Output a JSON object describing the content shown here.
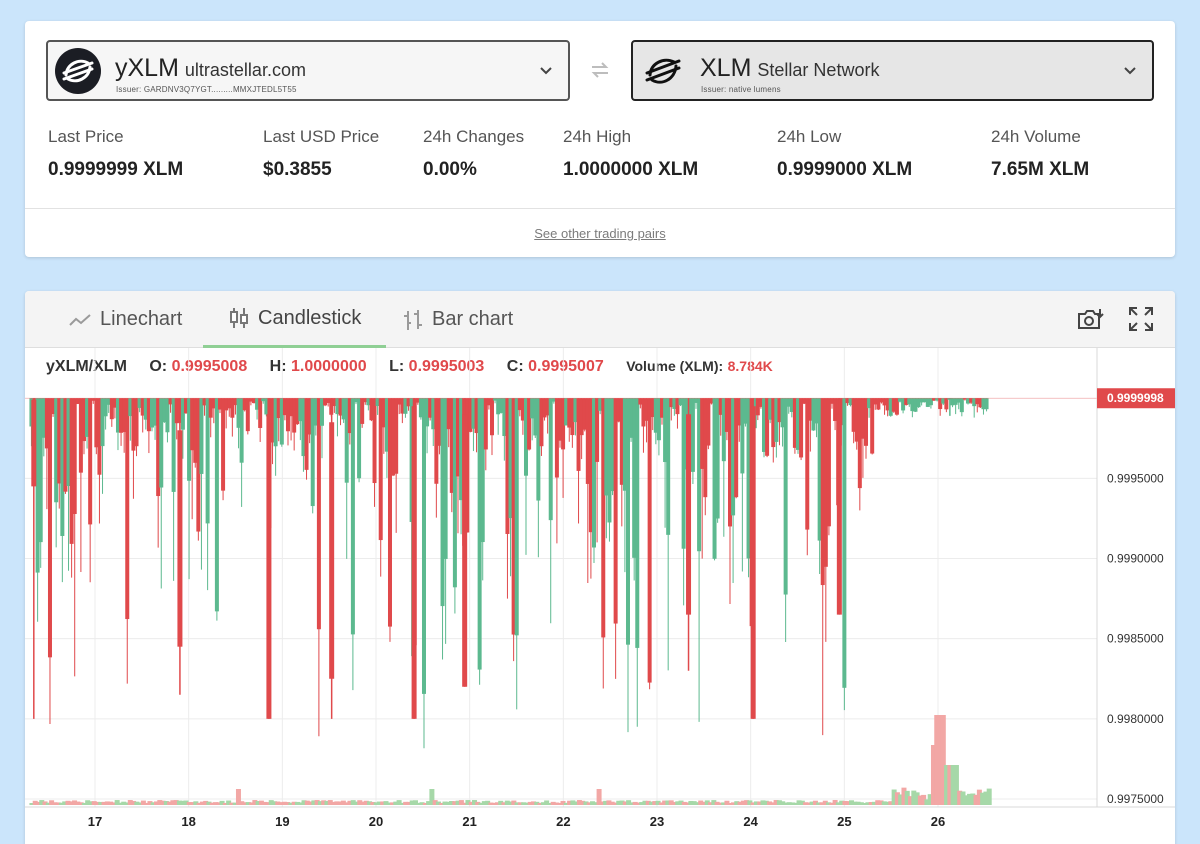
{
  "pair": {
    "base": {
      "code": "yXLM",
      "domain": "ultrastellar.com",
      "issuer": "Issuer: GARDNV3Q7YGT.........MMXJTEDL5T55",
      "icon": "stellar-rocket-icon"
    },
    "counter": {
      "code": "XLM",
      "domain": "Stellar Network",
      "issuer": "Issuer: native lumens",
      "icon": "stellar-rocket-icon"
    },
    "swap_icon": "swap-arrows-icon"
  },
  "stats": [
    {
      "label": "Last Price",
      "value": "0.9999999 XLM"
    },
    {
      "label": "Last USD Price",
      "value": "$0.3855"
    },
    {
      "label": "24h Changes",
      "value": "0.00%"
    },
    {
      "label": "24h High",
      "value": "1.0000000 XLM"
    },
    {
      "label": "24h Low",
      "value": "0.9999000 XLM"
    },
    {
      "label": "24h Volume",
      "value": "7.65M XLM"
    }
  ],
  "other_pairs_link": "See other trading pairs",
  "tabs": [
    {
      "label": "Linechart",
      "icon": "linechart-icon",
      "active": false
    },
    {
      "label": "Candlestick",
      "icon": "candlestick-icon",
      "active": true
    },
    {
      "label": "Bar chart",
      "icon": "barchart-icon",
      "active": false
    }
  ],
  "tools": {
    "screenshot_icon": "camera-icon",
    "fullscreen_icon": "fullscreen-icon"
  },
  "legend": {
    "pair": "yXLM/XLM",
    "o_label": "O:",
    "o_value": "0.9995008",
    "h_label": "H:",
    "h_value": "1.0000000",
    "l_label": "L:",
    "l_value": "0.9995003",
    "c_label": "C:",
    "c_value": "0.9995007",
    "volume_label": "Volume (XLM):",
    "volume_value": "8.784K"
  },
  "colors": {
    "up": "#5cb98f",
    "down": "#e0494b",
    "vol_up": "#a6d8a8",
    "vol_down": "#f2a7a5",
    "price_tag": "#e0494b"
  },
  "chart_data": {
    "type": "candlestick",
    "x_ticks": [
      "17",
      "18",
      "19",
      "20",
      "21",
      "22",
      "23",
      "24",
      "25",
      "26"
    ],
    "y_ticks": [
      "0.9995000",
      "0.9990000",
      "0.9985000",
      "0.9980000",
      "0.9975000"
    ],
    "y_tick_values": [
      0.9995,
      0.999,
      0.9985,
      0.998,
      0.9975
    ],
    "ylim": [
      0.99745,
      1.00002
    ],
    "last_price_label": "0.9999998",
    "last_price": 0.9999998,
    "x_start_day": 16.3,
    "x_end_day": 26.55,
    "notable_candles": [
      {
        "day": 16.32,
        "open": 0.99999,
        "close": 0.99945,
        "high": 1.0,
        "low": 0.998
      },
      {
        "day": 17.88,
        "open": 0.9998,
        "close": 0.99845,
        "high": 1.0,
        "low": 0.99815
      },
      {
        "day": 18.83,
        "open": 0.9999,
        "close": 0.998,
        "high": 1.0,
        "low": 0.998
      },
      {
        "day": 19.5,
        "open": 0.99985,
        "close": 0.99825,
        "high": 1.0,
        "low": 0.998
      },
      {
        "day": 20.38,
        "open": 0.99995,
        "close": 0.998,
        "high": 1.0,
        "low": 0.998
      },
      {
        "day": 20.92,
        "open": 0.9999,
        "close": 0.9982,
        "high": 1.0,
        "low": 0.9982
      },
      {
        "day": 23.31,
        "open": 0.9999,
        "close": 0.99865,
        "high": 1.0,
        "low": 0.9983
      },
      {
        "day": 24.0,
        "open": 0.99995,
        "close": 0.998,
        "high": 1.0,
        "low": 0.998
      },
      {
        "day": 24.92,
        "open": 0.9999,
        "close": 0.99865,
        "high": 1.0,
        "low": 0.99865
      },
      {
        "day": 26.1,
        "open": 0.99999,
        "close": 1.0,
        "high": 1.0,
        "low": 0.99989
      }
    ],
    "volume_spikes": [
      {
        "day": 18.5,
        "volume": "high"
      },
      {
        "day": 20.58,
        "volume": "medium"
      },
      {
        "day": 22.35,
        "volume": "medium"
      },
      {
        "day": 26.0,
        "volume": "very high"
      }
    ]
  }
}
